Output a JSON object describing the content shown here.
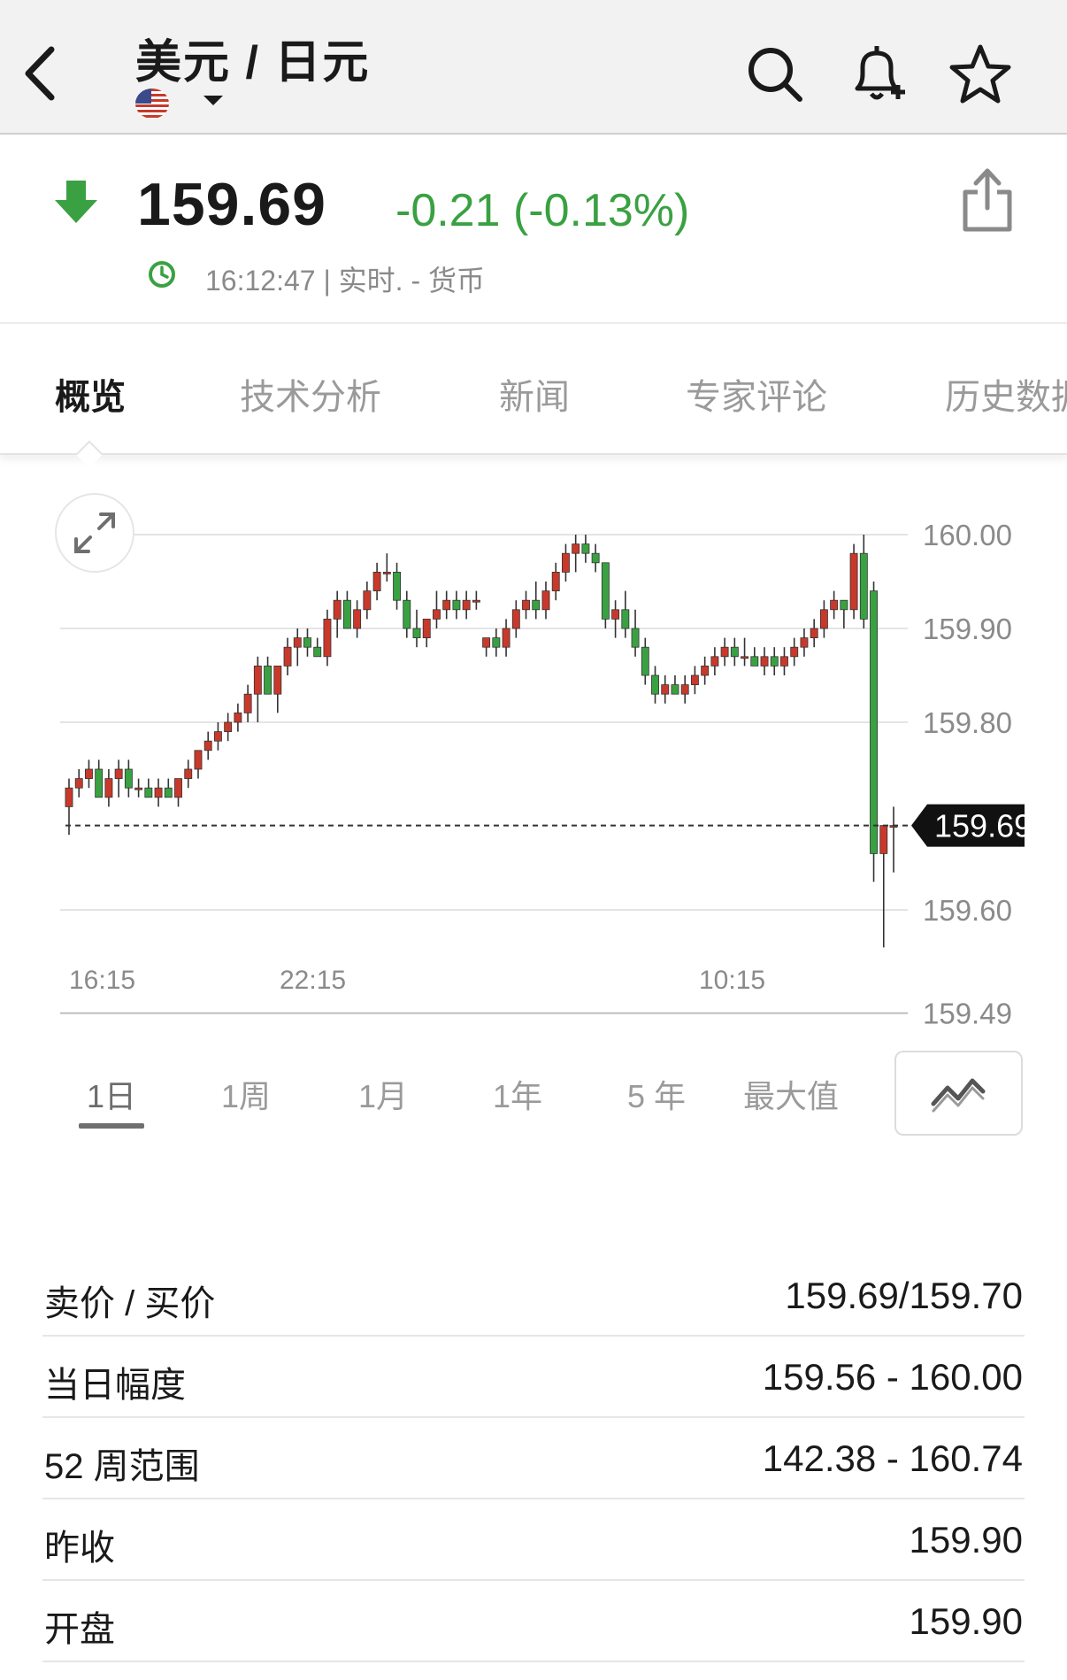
{
  "header": {
    "title": "美元 / 日元",
    "back_icon": "chevron-left-icon",
    "flag_icon": "us-flag-icon",
    "icons": [
      "search-icon",
      "bell-plus-icon",
      "star-icon"
    ]
  },
  "quote": {
    "price": "159.69",
    "change": "-0.21 (-0.13%)",
    "status": "16:12:47 | 实时. - 货币",
    "direction": "down",
    "colors": {
      "up": "#c8392b",
      "down": "#3aa142"
    }
  },
  "tabs": [
    "概览",
    "技术分析",
    "新闻",
    "专家评论",
    "历史数据"
  ],
  "active_tab": 0,
  "chart_data": {
    "type": "candlestick",
    "y_ticks": [
      "160.00",
      "159.90",
      "159.80",
      "159.60",
      "159.49"
    ],
    "x_ticks": [
      "16:15",
      "22:15",
      "10:15"
    ],
    "current_price_label": "159.69",
    "ylim": [
      159.49,
      160.05
    ],
    "grid": true,
    "candles": [
      [
        159.71,
        159.74,
        159.68,
        159.73
      ],
      [
        159.73,
        159.75,
        159.72,
        159.74
      ],
      [
        159.74,
        159.76,
        159.73,
        159.75
      ],
      [
        159.75,
        159.76,
        159.72,
        159.72
      ],
      [
        159.72,
        159.75,
        159.71,
        159.74
      ],
      [
        159.74,
        159.76,
        159.72,
        159.75
      ],
      [
        159.75,
        159.76,
        159.72,
        159.73
      ],
      [
        159.73,
        159.74,
        159.72,
        159.73
      ],
      [
        159.73,
        159.74,
        159.72,
        159.72
      ],
      [
        159.72,
        159.74,
        159.71,
        159.73
      ],
      [
        159.73,
        159.74,
        159.72,
        159.72
      ],
      [
        159.72,
        159.74,
        159.71,
        159.74
      ],
      [
        159.74,
        159.76,
        159.73,
        159.75
      ],
      [
        159.75,
        159.77,
        159.74,
        159.77
      ],
      [
        159.77,
        159.79,
        159.76,
        159.78
      ],
      [
        159.78,
        159.8,
        159.77,
        159.79
      ],
      [
        159.79,
        159.81,
        159.78,
        159.8
      ],
      [
        159.8,
        159.82,
        159.79,
        159.81
      ],
      [
        159.81,
        159.84,
        159.8,
        159.83
      ],
      [
        159.83,
        159.87,
        159.8,
        159.86
      ],
      [
        159.86,
        159.87,
        159.83,
        159.83
      ],
      [
        159.83,
        159.86,
        159.81,
        159.86
      ],
      [
        159.86,
        159.89,
        159.85,
        159.88
      ],
      [
        159.88,
        159.9,
        159.86,
        159.89
      ],
      [
        159.89,
        159.9,
        159.87,
        159.88
      ],
      [
        159.88,
        159.89,
        159.87,
        159.87
      ],
      [
        159.87,
        159.92,
        159.86,
        159.91
      ],
      [
        159.91,
        159.94,
        159.89,
        159.93
      ],
      [
        159.93,
        159.94,
        159.9,
        159.9
      ],
      [
        159.9,
        159.93,
        159.89,
        159.92
      ],
      [
        159.92,
        159.95,
        159.91,
        159.94
      ],
      [
        159.94,
        159.97,
        159.93,
        159.96
      ],
      [
        159.96,
        159.98,
        159.95,
        159.96
      ],
      [
        159.96,
        159.97,
        159.92,
        159.93
      ],
      [
        159.93,
        159.94,
        159.89,
        159.9
      ],
      [
        159.9,
        159.92,
        159.88,
        159.89
      ],
      [
        159.89,
        159.91,
        159.88,
        159.91
      ],
      [
        159.91,
        159.94,
        159.9,
        159.92
      ],
      [
        159.92,
        159.94,
        159.91,
        159.93
      ],
      [
        159.93,
        159.94,
        159.91,
        159.92
      ],
      [
        159.92,
        159.94,
        159.91,
        159.93
      ],
      [
        159.93,
        159.94,
        159.92,
        159.93
      ],
      [
        159.88,
        159.89,
        159.87,
        159.89
      ],
      [
        159.89,
        159.9,
        159.87,
        159.88
      ],
      [
        159.88,
        159.91,
        159.87,
        159.9
      ],
      [
        159.9,
        159.93,
        159.89,
        159.92
      ],
      [
        159.92,
        159.94,
        159.91,
        159.93
      ],
      [
        159.93,
        159.95,
        159.91,
        159.92
      ],
      [
        159.92,
        159.95,
        159.91,
        159.94
      ],
      [
        159.94,
        159.97,
        159.93,
        159.96
      ],
      [
        159.96,
        159.99,
        159.95,
        159.98
      ],
      [
        159.98,
        160.0,
        159.96,
        159.99
      ],
      [
        159.99,
        160.0,
        159.97,
        159.98
      ],
      [
        159.98,
        159.99,
        159.96,
        159.97
      ],
      [
        159.97,
        159.97,
        159.9,
        159.91
      ],
      [
        159.91,
        159.93,
        159.89,
        159.92
      ],
      [
        159.92,
        159.94,
        159.89,
        159.9
      ],
      [
        159.9,
        159.92,
        159.87,
        159.88
      ],
      [
        159.88,
        159.89,
        159.84,
        159.85
      ],
      [
        159.85,
        159.86,
        159.82,
        159.83
      ],
      [
        159.83,
        159.85,
        159.82,
        159.84
      ],
      [
        159.84,
        159.85,
        159.83,
        159.83
      ],
      [
        159.83,
        159.85,
        159.82,
        159.84
      ],
      [
        159.84,
        159.86,
        159.83,
        159.85
      ],
      [
        159.85,
        159.87,
        159.84,
        159.86
      ],
      [
        159.86,
        159.88,
        159.85,
        159.87
      ],
      [
        159.87,
        159.89,
        159.86,
        159.88
      ],
      [
        159.88,
        159.89,
        159.86,
        159.87
      ],
      [
        159.87,
        159.89,
        159.86,
        159.87
      ],
      [
        159.87,
        159.88,
        159.86,
        159.86
      ],
      [
        159.86,
        159.88,
        159.85,
        159.87
      ],
      [
        159.87,
        159.88,
        159.85,
        159.86
      ],
      [
        159.86,
        159.88,
        159.85,
        159.87
      ],
      [
        159.87,
        159.89,
        159.86,
        159.88
      ],
      [
        159.88,
        159.9,
        159.87,
        159.89
      ],
      [
        159.89,
        159.91,
        159.88,
        159.9
      ],
      [
        159.9,
        159.93,
        159.89,
        159.92
      ],
      [
        159.92,
        159.94,
        159.91,
        159.93
      ],
      [
        159.93,
        159.93,
        159.9,
        159.92
      ],
      [
        159.92,
        159.99,
        159.91,
        159.98
      ],
      [
        159.98,
        160.0,
        159.9,
        159.91
      ],
      [
        159.94,
        159.95,
        159.63,
        159.66
      ],
      [
        159.66,
        159.69,
        159.56,
        159.69
      ],
      [
        159.69,
        159.71,
        159.64,
        159.69
      ]
    ]
  },
  "ranges": [
    "1日",
    "1周",
    "1月",
    "1年",
    "5 年",
    "最大值"
  ],
  "active_range": 0,
  "chart_type_icon": "line-chart-icon",
  "stats": [
    {
      "label": "卖价 / 买价",
      "value": "159.69/159.70"
    },
    {
      "label": "当日幅度",
      "value": "159.56 - 160.00"
    },
    {
      "label": "52 周范围",
      "value": "142.38 - 160.74"
    },
    {
      "label": "昨收",
      "value": "159.90"
    },
    {
      "label": "开盘",
      "value": "159.90"
    }
  ]
}
